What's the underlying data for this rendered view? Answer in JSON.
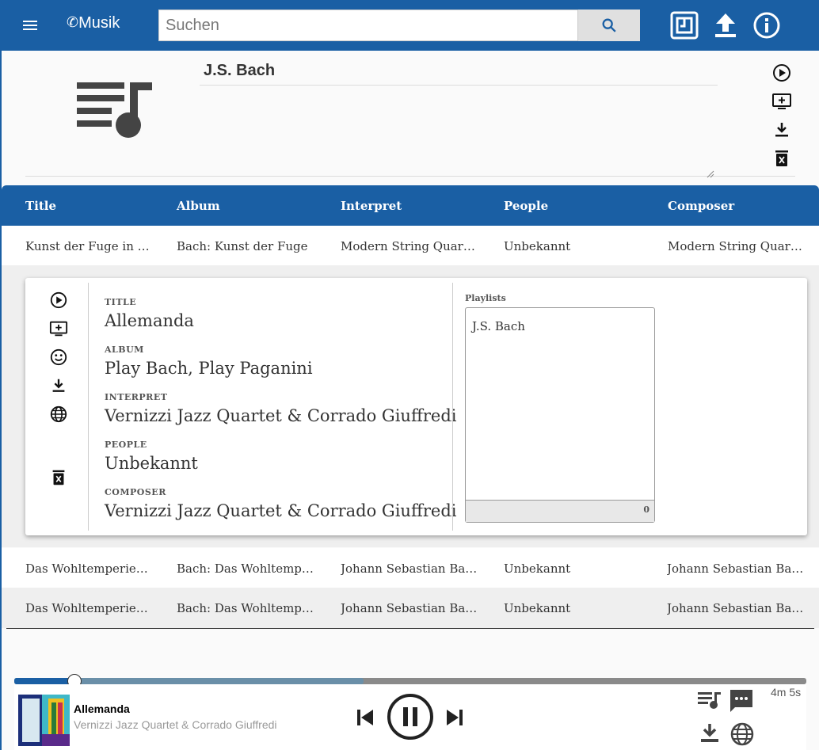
{
  "app": {
    "logo_text": "Musik"
  },
  "header": {
    "search_placeholder": "Suchen",
    "icons": [
      "menu-icon",
      "search-icon",
      "qr-code-icon",
      "upload-icon",
      "info-icon"
    ]
  },
  "playlist": {
    "name": "J.S. Bach",
    "actions": [
      "play-circle-icon",
      "add-to-queue-icon",
      "download-icon",
      "delete-icon"
    ]
  },
  "table": {
    "columns": [
      "Title",
      "Album",
      "Interpret",
      "People",
      "Composer"
    ],
    "rows": [
      [
        "Kunst der Fuge in …",
        "Bach: Kunst der Fuge",
        "Modern String Quar…",
        "Unbekannt",
        "Modern String Quar…"
      ],
      [
        "Das Wohltemperie…",
        "Bach: Das Wohltemp…",
        "Johann Sebastian Ba…",
        "Unbekannt",
        "Johann Sebastian Ba…"
      ],
      [
        "Das Wohltemperie…",
        "Bach: Das Wohltemp…",
        "Johann Sebastian Ba…",
        "Unbekannt",
        "Johann Sebastian Ba…"
      ]
    ]
  },
  "detail": {
    "fields": [
      {
        "label": "TITLE",
        "value": "Allemanda"
      },
      {
        "label": "ALBUM",
        "value": "Play Bach, Play Paganini"
      },
      {
        "label": "INTERPRET",
        "value": "Vernizzi Jazz Quartet & Corrado Giuffredi"
      },
      {
        "label": "PEOPLE",
        "value": "Unbekannt"
      },
      {
        "label": "COMPOSER",
        "value": "Vernizzi Jazz Quartet & Corrado Giuffredi"
      }
    ],
    "playlists_label": "Playlists",
    "playlists": [
      "J.S. Bach"
    ],
    "playlists_count": "0",
    "actions": [
      "play-circle-icon",
      "add-to-queue-icon",
      "emoji-icon",
      "download-icon",
      "globe-icon",
      "delete-icon"
    ]
  },
  "player": {
    "title": "Allemanda",
    "artist": "Vernizzi Jazz Quartet & Corrado Giuffredi",
    "duration": "4m 5s",
    "progress_played": 0.076,
    "progress_buffered": 0.441
  },
  "colors": {
    "primary": "#1a5fa4",
    "stripe": "#efefef"
  }
}
